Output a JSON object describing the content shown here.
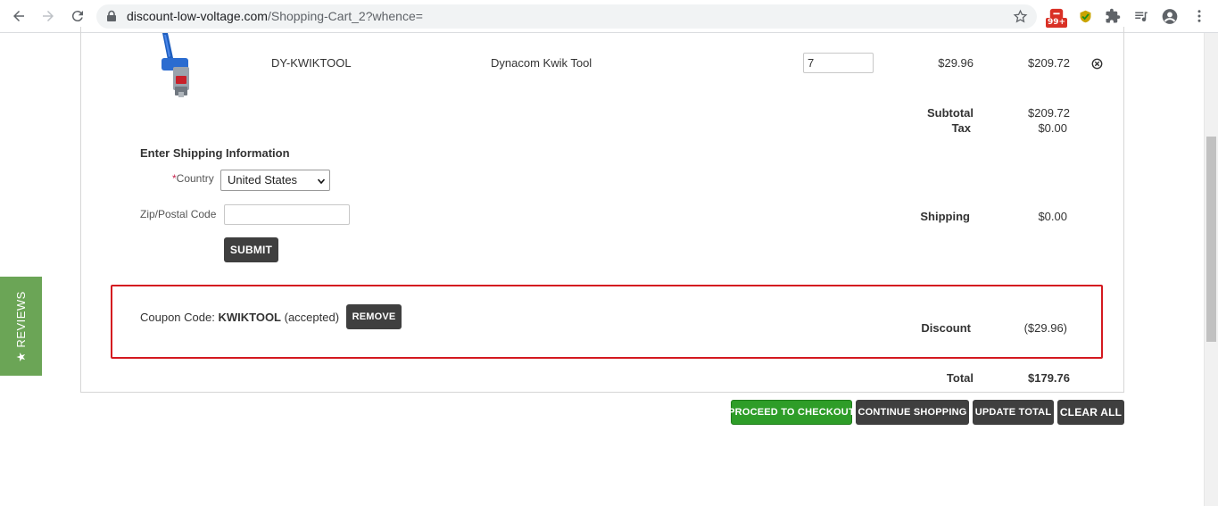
{
  "browser": {
    "url_domain": "discount-low-voltage.com",
    "url_path": "/Shopping-Cart_2?whence=",
    "extension_badge": "99+"
  },
  "reviews_tab": {
    "label": "★ REVIEWS"
  },
  "cart": {
    "item": {
      "sku": "DY-KWIKTOOL",
      "name": "Dynacom Kwik Tool",
      "quantity": "7",
      "unit_price": "$29.96",
      "line_total": "$209.72"
    },
    "summary": {
      "subtotal_label": "Subtotal",
      "subtotal_value": "$209.72",
      "tax_label": "Tax",
      "tax_value": "$0.00",
      "shipping_label": "Shipping",
      "shipping_value": "$0.00",
      "discount_label": "Discount",
      "discount_value": "($29.96)",
      "total_label": "Total",
      "total_value": "$179.76"
    },
    "shipping_form": {
      "title": "Enter Shipping Information",
      "required_mark": "*",
      "country_label": "Country",
      "country_value": "United States",
      "zip_label": "Zip/Postal Code",
      "zip_value": "",
      "submit_label": "SUBMIT"
    },
    "coupon": {
      "prefix": "Coupon Code:",
      "code": "KWIKTOOL",
      "status": "(accepted)",
      "remove_label": "REMOVE"
    },
    "actions": {
      "checkout_label": "PROCEED TO CHECKOUT",
      "continue_label": "CONTINUE SHOPPING",
      "update_label": "UPDATE TOTAL",
      "clear_label": "CLEAR ALL"
    }
  },
  "colors": {
    "highlight_border": "#d41920",
    "checkout_green": "#2e9d28",
    "dark_button": "#3f3f3f",
    "reviews_green": "#6ba556"
  }
}
